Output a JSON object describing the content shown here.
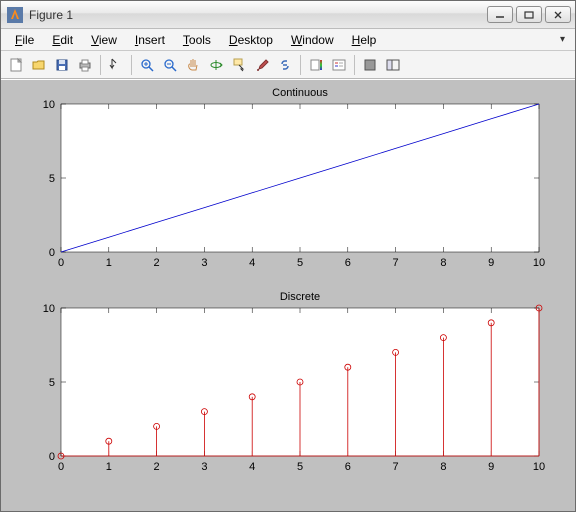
{
  "window": {
    "title": "Figure 1"
  },
  "menu": {
    "file": "File",
    "edit": "Edit",
    "view": "View",
    "insert": "Insert",
    "tools": "Tools",
    "desktop": "Desktop",
    "window": "Window",
    "help": "Help"
  },
  "toolbar_icons": {
    "new": "new-figure",
    "open": "open",
    "save": "save",
    "print": "print",
    "edit": "edit-plot",
    "zoomin": "zoom-in",
    "zoomout": "zoom-out",
    "pan": "pan",
    "rotate": "rotate-3d",
    "cursor": "data-cursor",
    "brush": "brush",
    "link": "link-data",
    "colorbar": "insert-colorbar",
    "legend": "insert-legend",
    "hide": "hide-tools",
    "dock": "dock"
  },
  "chart_data": [
    {
      "type": "line",
      "title": "Continuous",
      "x": [
        0,
        1,
        2,
        3,
        4,
        5,
        6,
        7,
        8,
        9,
        10
      ],
      "values": [
        0,
        1,
        2,
        3,
        4,
        5,
        6,
        7,
        8,
        9,
        10
      ],
      "xlim": [
        0,
        10
      ],
      "ylim": [
        0,
        10
      ],
      "xticks": [
        0,
        1,
        2,
        3,
        4,
        5,
        6,
        7,
        8,
        9,
        10
      ],
      "yticks": [
        0,
        5,
        10
      ]
    },
    {
      "type": "stem",
      "title": "Discrete",
      "x": [
        0,
        1,
        2,
        3,
        4,
        5,
        6,
        7,
        8,
        9,
        10
      ],
      "values": [
        0,
        1,
        2,
        3,
        4,
        5,
        6,
        7,
        8,
        9,
        10
      ],
      "xlim": [
        0,
        10
      ],
      "ylim": [
        0,
        10
      ],
      "xticks": [
        0,
        1,
        2,
        3,
        4,
        5,
        6,
        7,
        8,
        9,
        10
      ],
      "yticks": [
        0,
        5,
        10
      ]
    }
  ]
}
